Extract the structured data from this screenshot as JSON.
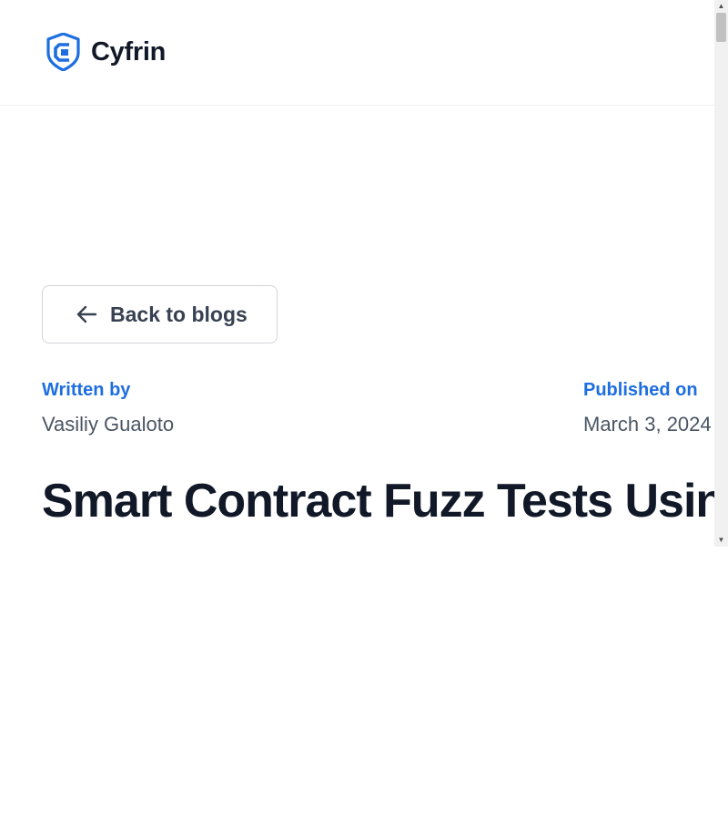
{
  "brand": {
    "name": "Cyfrin",
    "logo_icon": "shield-logo-icon",
    "brand_color": "#1d6ee0"
  },
  "nav": {
    "back_label": "Back to blogs",
    "back_icon": "arrow-left-icon"
  },
  "article": {
    "author_label": "Written by",
    "author_name": "Vasiliy Gualoto",
    "published_label": "Published on",
    "published_date": "March 3, 2024",
    "title": "Smart Contract Fuzz Tests Using Foundry | Full guide (updated)"
  },
  "colors": {
    "accent": "#1d6ee0",
    "text_primary": "#111827",
    "text_secondary": "#4b5563"
  }
}
